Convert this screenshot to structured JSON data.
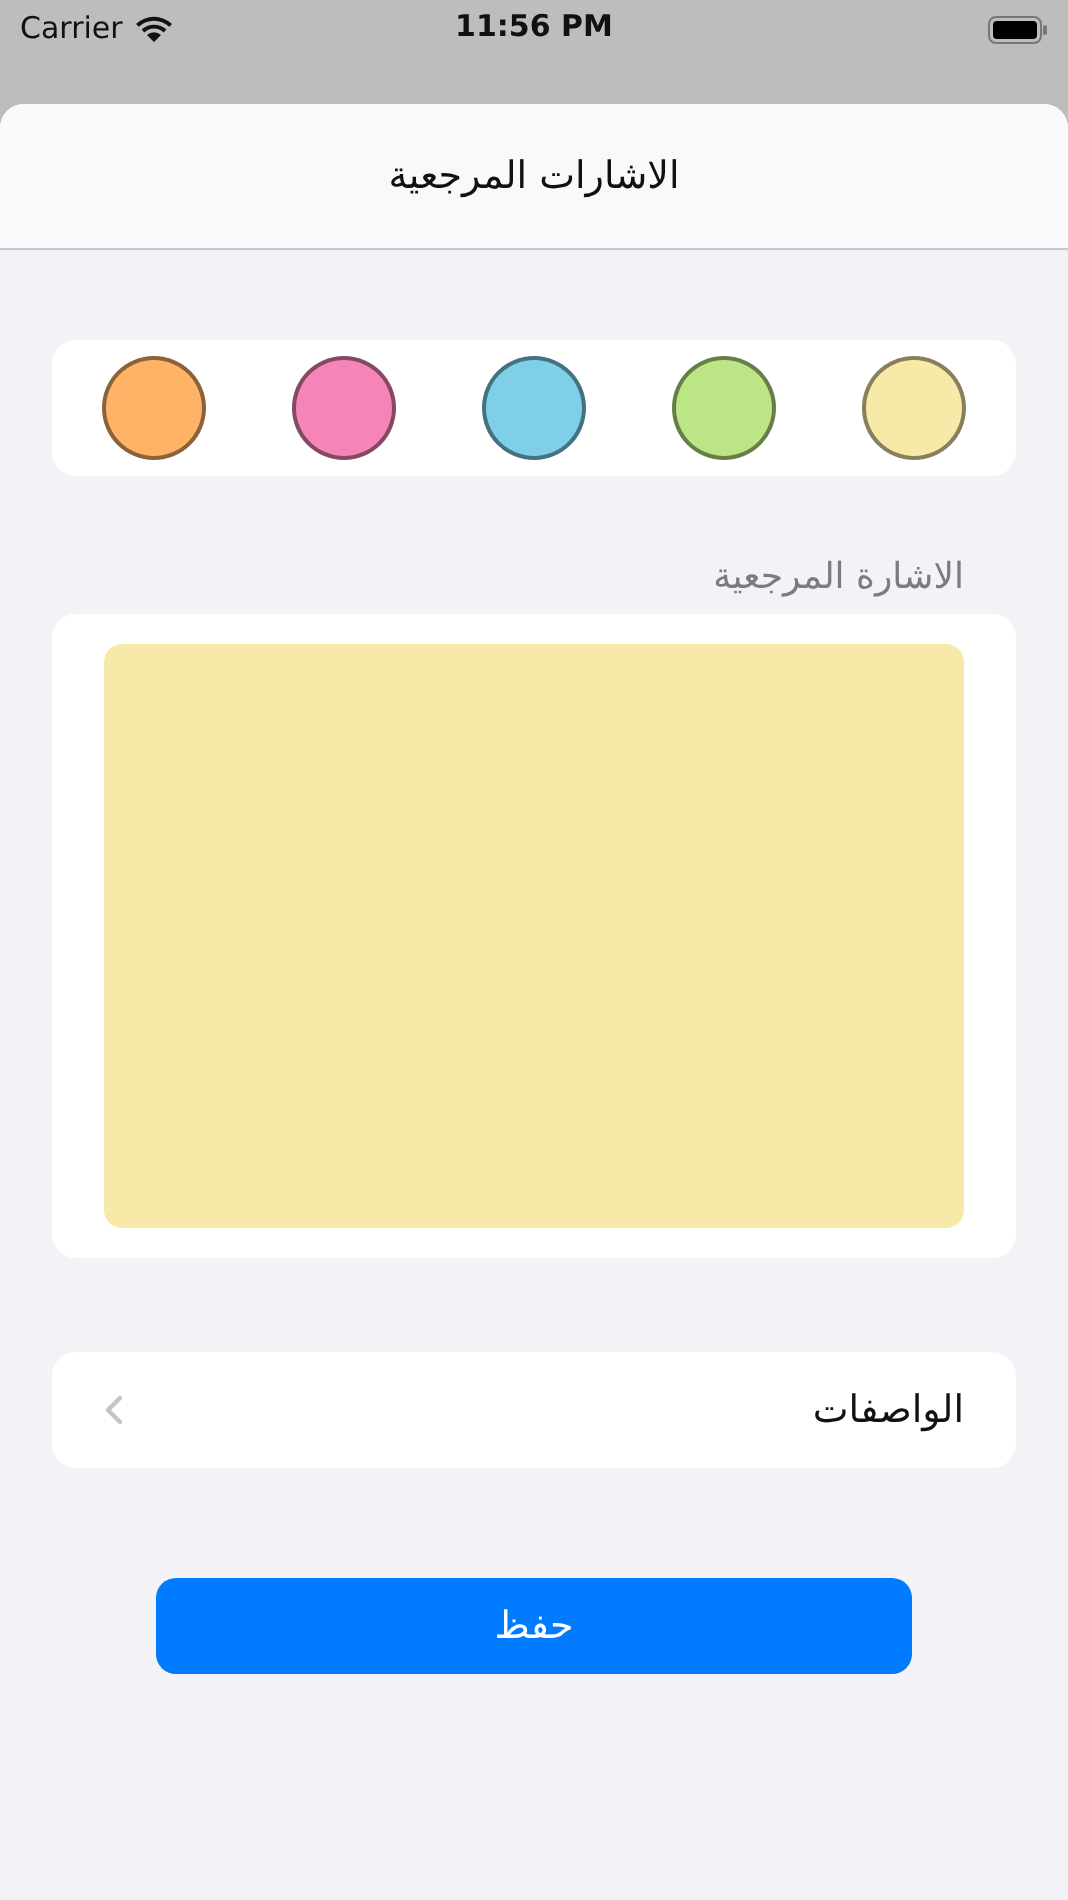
{
  "status_bar": {
    "carrier": "Carrier",
    "time": "11:56 PM"
  },
  "sheet": {
    "title": "الاشارات المرجعية"
  },
  "swatches": [
    {
      "color": "#ffb366"
    },
    {
      "color": "#f584b9"
    },
    {
      "color": "#7fcfe9"
    },
    {
      "color": "#bce585"
    },
    {
      "color": "#f7eaa8"
    }
  ],
  "note_label": "الاشارة المرجعية",
  "note": {
    "color": "#f7eaa8"
  },
  "descriptions_row": {
    "label": "الواصفات"
  },
  "save_button": "حفظ"
}
